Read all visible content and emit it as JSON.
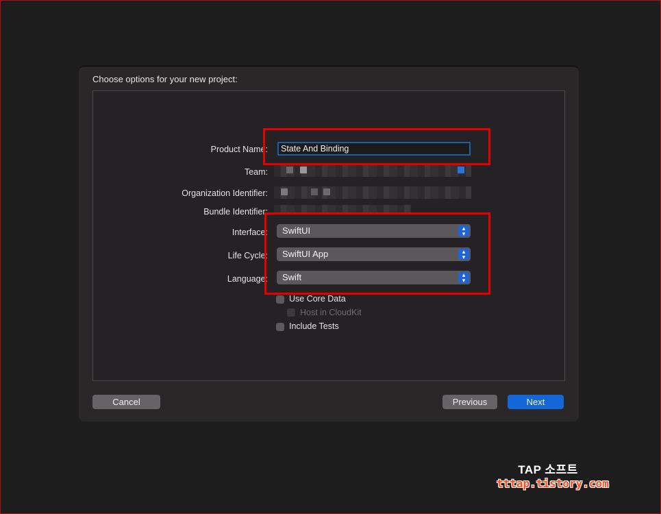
{
  "dialog": {
    "title": "Choose options for your new project:"
  },
  "form": {
    "product_name_label": "Product Name:",
    "product_name_value": "State And Binding",
    "team_label": "Team:",
    "org_label": "Organization Identifier:",
    "bundle_label": "Bundle Identifier:",
    "interface_label": "Interface:",
    "interface_value": "SwiftUI",
    "lifecycle_label": "Life Cycle:",
    "lifecycle_value": "SwiftUI App",
    "language_label": "Language:",
    "language_value": "Swift"
  },
  "options": {
    "core_data": "Use Core Data",
    "cloudkit": "Host in CloudKit",
    "tests": "Include Tests"
  },
  "buttons": {
    "cancel": "Cancel",
    "previous": "Previous",
    "next": "Next"
  },
  "watermark": {
    "line1": "TAP 소프트",
    "line2": "tttap.tistory.com"
  },
  "colors": {
    "accent": "#1467d8",
    "highlight_box": "#e80000"
  }
}
